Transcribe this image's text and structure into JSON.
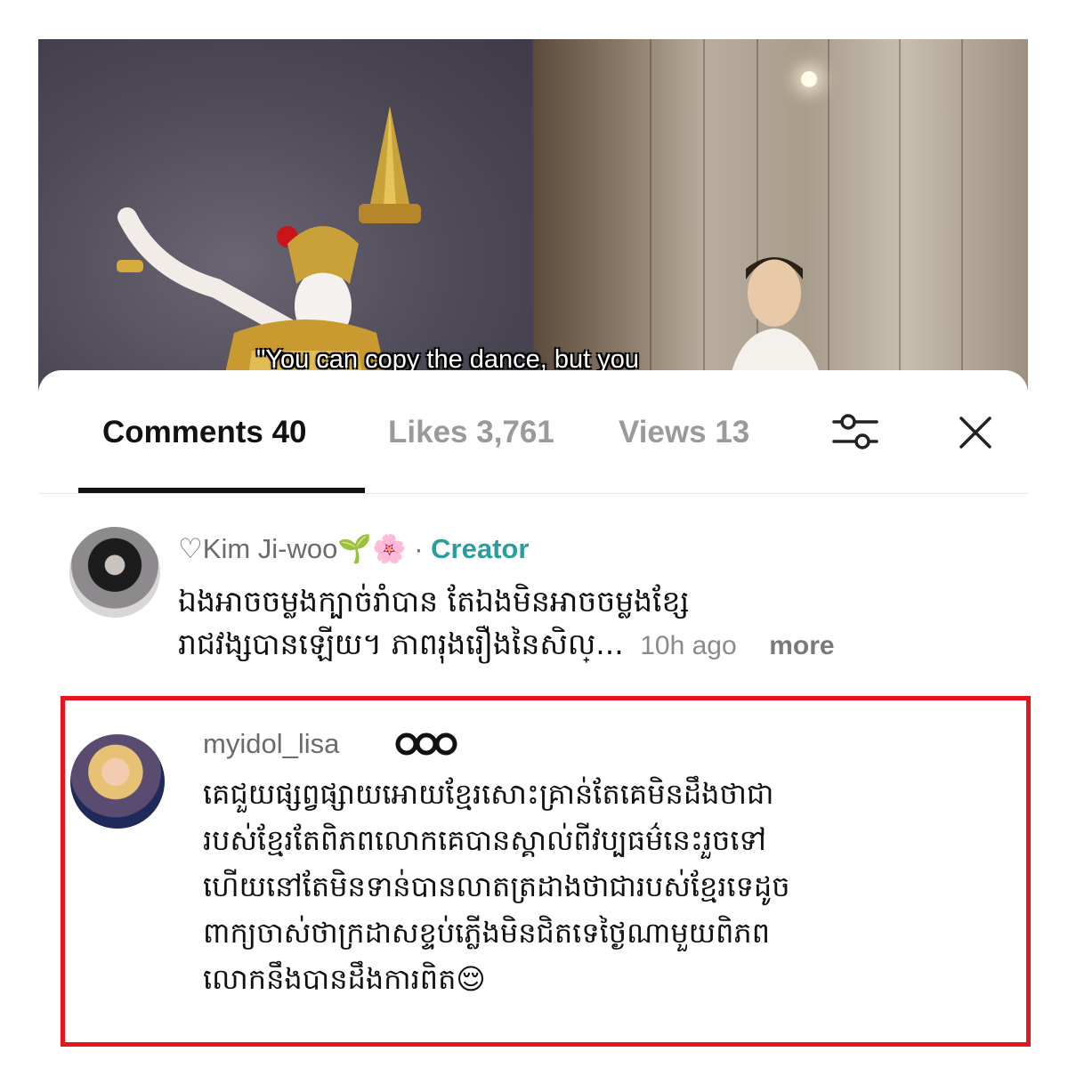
{
  "video": {
    "caption": "\"You can copy the dance, but you"
  },
  "tabs": {
    "comments": "Comments 40",
    "likes": "Likes 3,761",
    "views": "Views 13"
  },
  "icons": {
    "filter": "sliders-icon",
    "close": "close-icon",
    "badge": "chain-badge-icon"
  },
  "colors": {
    "creator": "#2a9d9f",
    "highlight": "#e8141b",
    "active_tab": "#111111",
    "inactive_tab": "#9a9a9a"
  },
  "comments": [
    {
      "username": "♡Kim Ji-woo🌱🌸",
      "separator": " · ",
      "role": "Creator",
      "lines": [
        "ឯងអាចចម្លងក្បាច់រាំបាន តែឯងមិនអាចចម្លងខ្សែ",
        "រាជវង្សបានឡើយ។ ភាពរុងរឿងនៃសិល្"
      ],
      "ellipsis": "...",
      "time": "10h ago",
      "more": "more"
    },
    {
      "username": "myidol_lisa",
      "lines": [
        "គេជួយផ្សព្វផ្សាយអោយខ្មែរសោះគ្រាន់តែគេមិនដឹងថាជា",
        "របស់ខ្មែរតែពិភពលោកគេបានស្គាល់ពីវប្បធម៌នេះរួចទៅ",
        "ហើយនៅតែមិនទាន់បានលាតត្រដាងថាជារបស់ខ្មែរទេដូច",
        "ពាក្យចាស់ថាក្រដាសខ្ទប់ភ្លើងមិនជិតទេថ្ងៃណាមួយពិភព",
        "លោកនឹងបានដឹងការពិត😌"
      ]
    }
  ]
}
